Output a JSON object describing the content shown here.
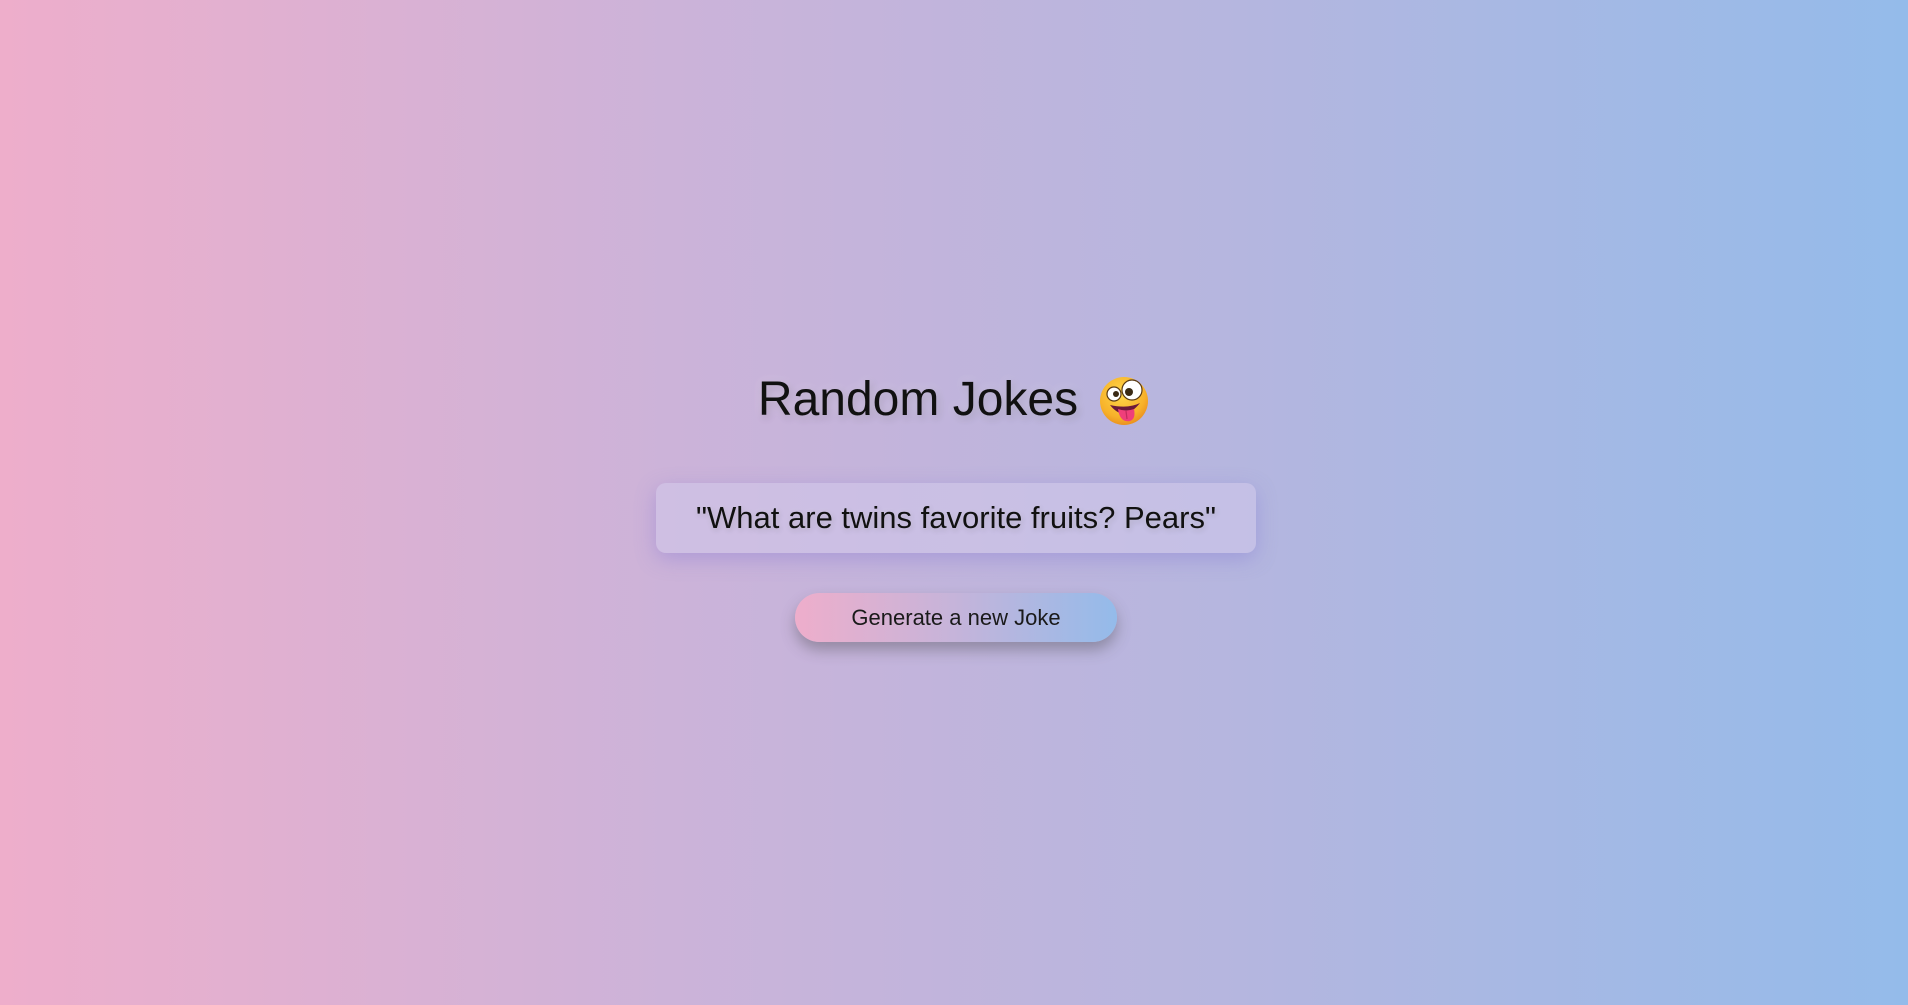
{
  "app": {
    "title": "Random Jokes",
    "title_icon": "crazy-face-emoji"
  },
  "joke": {
    "text": "\"What are twins favorite fruits? Pears\""
  },
  "actions": {
    "generate_label": "Generate a new Joke"
  },
  "colors": {
    "gradient_left": "#eeaecb",
    "gradient_mid": "#c5b4da",
    "gradient_right": "#94bbea",
    "text": "#111111"
  }
}
